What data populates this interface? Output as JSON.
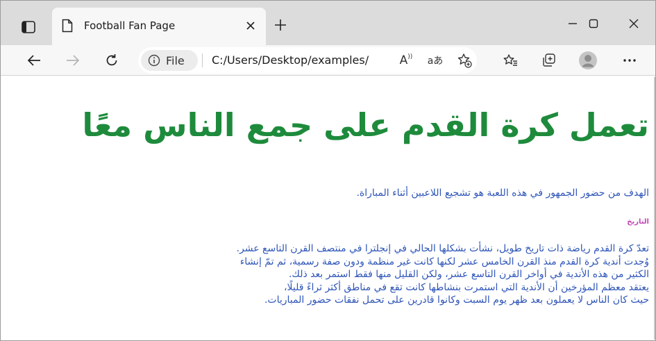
{
  "browser": {
    "tab": {
      "title": "Football Fan Page"
    },
    "address": {
      "site_info_label": "File",
      "url": "C:/Users/Desktop/examples/",
      "read_aloud_label": "A",
      "translate_label": "aあ"
    },
    "icons": {
      "tab_actions": "tab-actions-icon",
      "page": "page-icon",
      "close_tab": "close-icon",
      "new_tab": "plus-icon",
      "minimize": "minimize-icon",
      "maximize": "maximize-icon",
      "close_window": "close-icon",
      "back": "arrow-left-icon",
      "forward": "arrow-right-icon",
      "refresh": "refresh-icon",
      "info": "info-icon",
      "read_aloud": "read-aloud-icon",
      "translate": "translate-icon",
      "add_favorite": "star-plus-icon",
      "favorites": "favorites-icon",
      "collections": "collections-icon",
      "profile": "avatar-icon",
      "menu": "ellipsis-icon"
    },
    "colors": {
      "tabstrip": "#dcdcdc",
      "toolbar": "#f7f7f7"
    }
  },
  "page": {
    "heading": "تعمل كرة القدم على جمع الناس معًا",
    "intro": "الهدف من حضور الجمهور في هذه اللعبة هو تشجيع اللاعبين أثناء المباراة.",
    "history_title": "التاريخ",
    "history_lines": [
      "تعدّ كرة القدم رياضة ذات تاريخ طويل، نشأت بشكلها الحالي في إنجلترا في منتصف القرن التاسع عشر.",
      "وُجدت أندية كرة القدم منذ القرن الخامس عشر لكنها كانت غير منظمة ودون صفة رسمية، ثم تمّ إنشاء",
      "الكثير من هذه الأندية في أواخر القرن التاسع عشر، ولكن القليل منها فقط استمر بعد ذلك.",
      "يعتقد معظم المؤرخين أن الأندية التي استمرت بنشاطها كانت تقع في مناطق أكثر ثراءً قليلًا،",
      "حيث كان الناس لا يعملون بعد ظهر يوم السبت وكانوا قادرين على تحمل نفقات حضور المباريات."
    ],
    "colors": {
      "heading": "#1e8b3c",
      "body_text": "#2e55b8",
      "history_title": "#c046b6"
    }
  }
}
